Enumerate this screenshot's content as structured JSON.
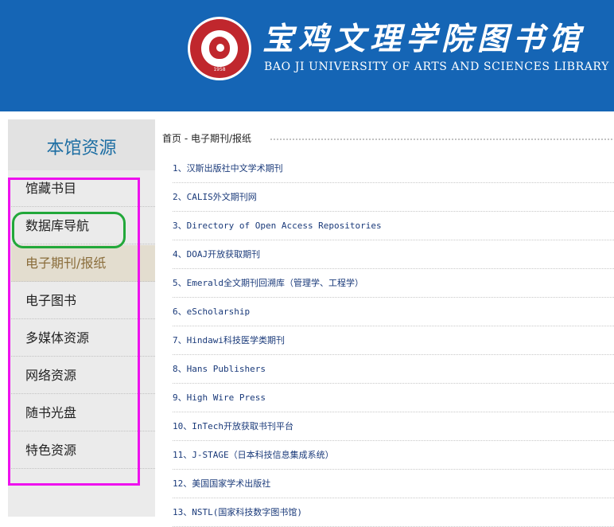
{
  "header": {
    "title_cn": "宝鸡文理学院图书馆",
    "title_en": "BAO JI UNIVERSITY OF ARTS AND SCIENCES LIBRARY",
    "logo_year": "1958"
  },
  "sidebar": {
    "title": "本馆资源",
    "items": [
      {
        "label": "馆藏书目",
        "active": false
      },
      {
        "label": "数据库导航",
        "active": false
      },
      {
        "label": "电子期刊/报纸",
        "active": true
      },
      {
        "label": "电子图书",
        "active": false
      },
      {
        "label": "多媒体资源",
        "active": false
      },
      {
        "label": "网络资源",
        "active": false
      },
      {
        "label": "随书光盘",
        "active": false
      },
      {
        "label": "特色资源",
        "active": false
      }
    ]
  },
  "breadcrumb": {
    "home": "首页",
    "separator": " - ",
    "current": "电子期刊/报纸"
  },
  "list": [
    "1、汉斯出版社中文学术期刊",
    "2、CALIS外文期刊网",
    "3、Directory of Open Access Repositories",
    "4、DOAJ开放获取期刊",
    "5、Emerald全文期刊回溯库（管理学、工程学）",
    "6、eScholarship",
    "7、Hindawi科技医学类期刊",
    "8、Hans Publishers",
    "9、High Wire Press",
    "10、InTech开放获取书刊平台",
    "11、J-STAGE（日本科技信息集成系统）",
    "12、美国国家学术出版社",
    "13、NSTL(国家科技数字图书馆)"
  ],
  "colors": {
    "header_bg": "#1565b5",
    "sidebar_title": "#1d6ea3",
    "active_item_bg": "#e3ddcf",
    "active_item_text": "#8a6d3b",
    "annotation_magenta": "#ee11ee",
    "annotation_green": "#22a83a"
  }
}
